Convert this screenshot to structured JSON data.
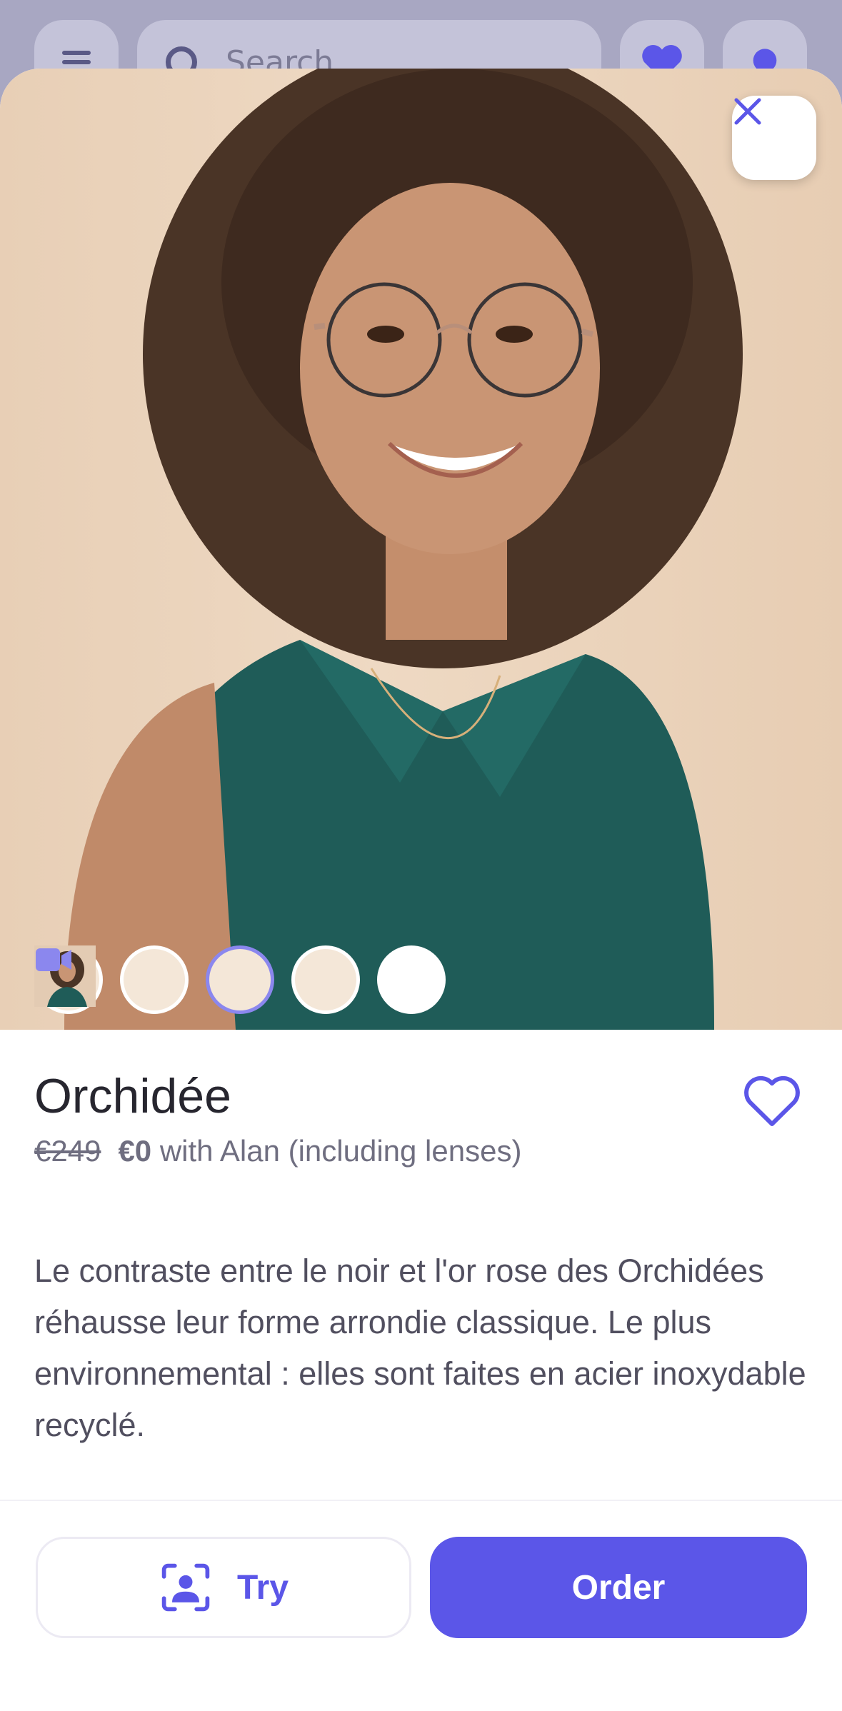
{
  "background_app": {
    "search_placeholder": "Search",
    "icons": [
      "menu-icon",
      "search-icon",
      "heart-icon",
      "account-icon"
    ]
  },
  "product": {
    "name": "Orchidée",
    "old_price": "€249",
    "new_price": "€0",
    "price_note": "with Alan (including lenses)",
    "description": "Le contraste entre le noir et l'or rose des Orchidées réhausse leur forme arrondie classique. Le plus environnemental : elles sont faites en acier inoxydable recyclé."
  },
  "gallery": {
    "thumbnails": [
      "frame-front",
      "frame-side",
      "model-photo-1",
      "model-photo-2",
      "video"
    ],
    "active_index": 2
  },
  "actions": {
    "try_label": "Try",
    "order_label": "Order"
  },
  "colors": {
    "accent": "#5b56e8",
    "text_primary": "#27262f",
    "text_secondary": "#6f6e80"
  }
}
